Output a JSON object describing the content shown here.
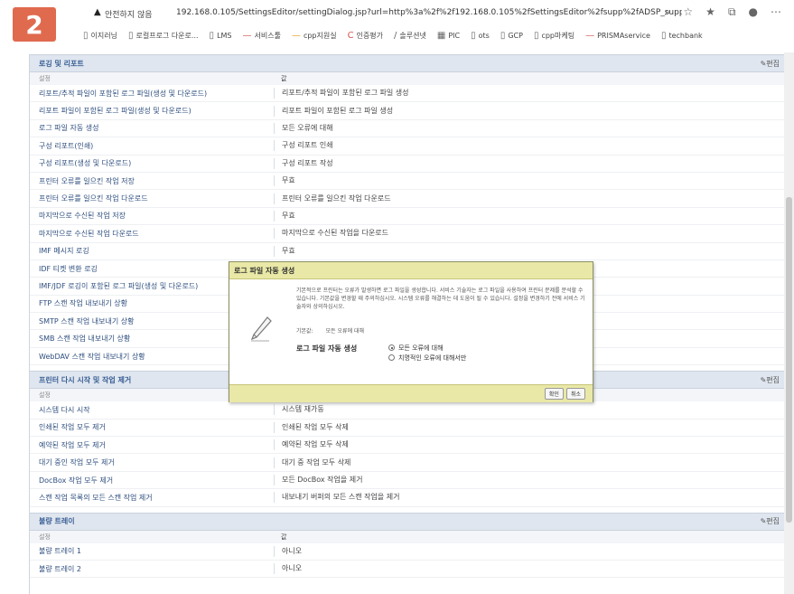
{
  "step_badge": "2",
  "browser": {
    "secure_label": "안전하지 않음",
    "url": "192.168.0.105/SettingsEditor/settingDialog.jsp?url=http%3a%2f%2f192.168.0.105%2fSettingsEditor%2fsupp%2fADSP_supp_logging.jsp&settingId=/Logging/..."
  },
  "bookmarks": [
    {
      "label": "이지러닝"
    },
    {
      "label": "로컬프로그 다운로..."
    },
    {
      "label": "LMS"
    },
    {
      "label": "서비스툴"
    },
    {
      "label": "cpp지원실"
    },
    {
      "label": "인증평가"
    },
    {
      "label": "솔루션넷"
    },
    {
      "label": "PIC"
    },
    {
      "label": "ots"
    },
    {
      "label": "GCP"
    },
    {
      "label": "cpp마케팅"
    },
    {
      "label": "PRISMAservice"
    },
    {
      "label": "techbank"
    }
  ],
  "sections": [
    {
      "title": "로깅 및 리포트",
      "edit": "편집",
      "col1": "설정",
      "col2": "값",
      "rows": [
        {
          "setting": "리포트/추적 파일이 포함된 로그 파일(생성 및 다운로드)",
          "value": "리포트/추적 파일이 포함된 로그 파일 생성"
        },
        {
          "setting": "리포트 파일이 포함된 로그 파일(생성 및 다운로드)",
          "value": "리포트 파일이 포함된 로그 파일 생성"
        },
        {
          "setting": "로그 파일 자동 생성",
          "value": "모든 오류에 대해"
        },
        {
          "setting": "구성 리포트(인쇄)",
          "value": "구성 리포트 인쇄"
        },
        {
          "setting": "구성 리포트(생성 및 다운로드)",
          "value": "구성 리포트 작성"
        },
        {
          "setting": "프린터 오류를 일으킨 작업 저장",
          "value": "무효"
        },
        {
          "setting": "프린터 오류를 일으킨 작업 다운로드",
          "value": "프린터 오류를 일으킨 작업 다운로드"
        },
        {
          "setting": "마지막으로 수신된 작업 저장",
          "value": "무효"
        },
        {
          "setting": "마지막으로 수신된 작업 다운로드",
          "value": "마지막으로 수신된 작업을 다운로드"
        },
        {
          "setting": "IMF 메시지 로깅",
          "value": "무효"
        },
        {
          "setting": "IDF 티켓 변환 로깅",
          "value": ""
        },
        {
          "setting": "IMF/JDF 로깅이 포함된 로그 파일(생성 및 다운로드)",
          "value": ""
        },
        {
          "setting": "FTP 스캔 작업 내보내기 상황",
          "value": ""
        },
        {
          "setting": "SMTP 스캔 작업 내보내기 상황",
          "value": ""
        },
        {
          "setting": "SMB 스캔 작업 내보내기 상황",
          "value": ""
        },
        {
          "setting": "WebDAV 스캔 작업 내보내기 상황",
          "value": ""
        }
      ]
    },
    {
      "title": "프린터 다시 시작 및 작업 제거",
      "edit": "편집",
      "col1": "설정",
      "col2": "값",
      "rows": [
        {
          "setting": "시스템 다시 시작",
          "value": "시스템 재가동"
        },
        {
          "setting": "인쇄된 작업 모두 제거",
          "value": "인쇄된 작업 모두 삭제"
        },
        {
          "setting": "예약된 작업 모두 제거",
          "value": "예약된 작업 모두 삭제"
        },
        {
          "setting": "대기 중인 작업 모두 제거",
          "value": "대기 중 작업 모두 삭제"
        },
        {
          "setting": "DocBox 작업 모두 제거",
          "value": "모든 DocBox 작업을 제거"
        },
        {
          "setting": "스캔 작업 목록의 모든 스캔 작업 제거",
          "value": "내보내기 버퍼의 모든 스캔 작업을 제거"
        }
      ]
    },
    {
      "title": "불량 트레이",
      "edit": "편집",
      "col1": "설정",
      "col2": "값",
      "rows": [
        {
          "setting": "불량 트레이 1",
          "value": "아니오"
        },
        {
          "setting": "불량 트레이 2",
          "value": "아니오"
        }
      ]
    }
  ],
  "dialog": {
    "title": "로그 파일 자동 생성",
    "description": "기본적으로 프린터는 오류가 발생하면 로그 파일을 생성합니다. 서비스 기술자는 로그 파일을 사용하여 프린터 문제를 분석할 수 있습니다. 기본값을 변경할 때 주의하십시오. 시스템 오류를 해결하는 데 도움이 될 수 있습니다. 설정을 변경하기 전에 서비스 기술자와 상의하십시오.",
    "default_label": "기본값:",
    "default_value": "모든 오류에 대해",
    "option_label": "로그 파일 자동 생성",
    "options": [
      {
        "label": "모든 오류에 대해",
        "selected": true
      },
      {
        "label": "치명적인 오류에 대해서만",
        "selected": false
      }
    ],
    "ok": "확인",
    "cancel": "취소"
  }
}
